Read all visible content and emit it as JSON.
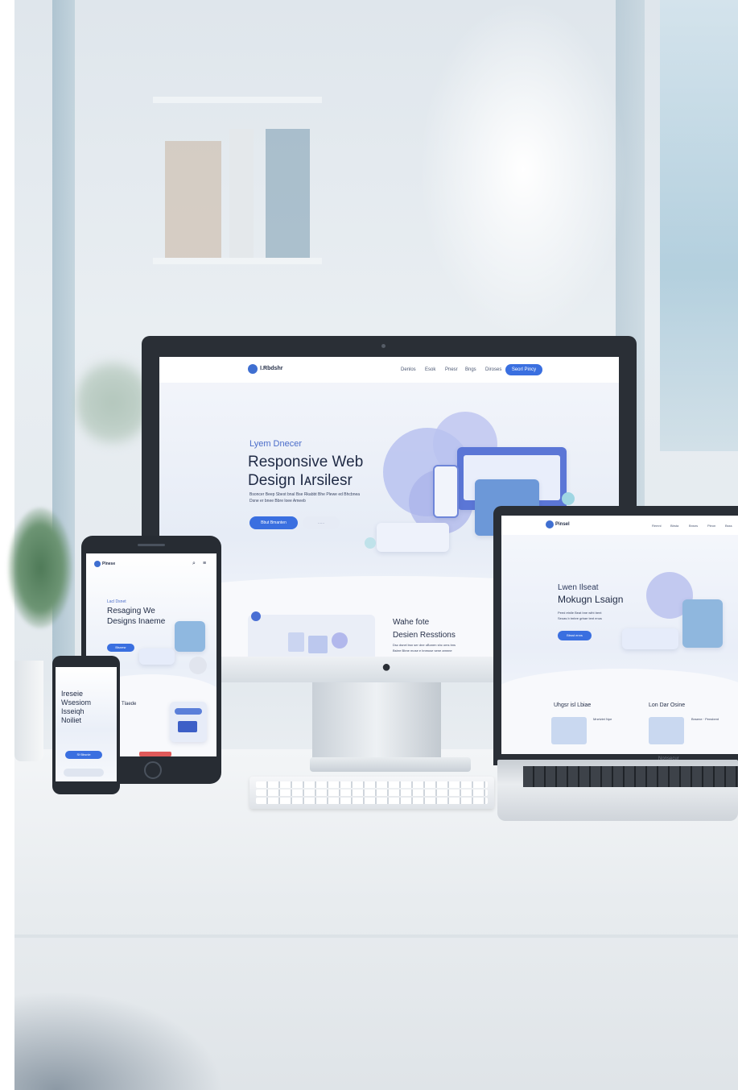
{
  "scene": {
    "colors": {
      "accent": "#3a6fe0",
      "bezel": "#2a2f36",
      "background": "#e3e9ee"
    }
  },
  "monitor": {
    "logo_text": "Ⅰ.Rbdshr",
    "logo_sub": "......",
    "nav_links": [
      "Denlos",
      "Esok",
      "Pnesr",
      "Bngs",
      "Diroses"
    ],
    "nav_cta": "Seorl Pincy",
    "kicker": "Lyem Dnecer",
    "headline_line1": "Responsive Web",
    "headline_line2": "Design Iᴀrsilesr",
    "body_line1": "Bsoncer Beep Sbest bnal Bse Rkabbt Bhe Plewe ed Bhcbnea",
    "body_line2": "Dsne er bnee Bbre loee Ameeb",
    "primary_button": "Bbut Bmanten",
    "secondary_button": "......",
    "section_title": "Wahe fote",
    "section_subtitle": "Desien Resstions",
    "section_body1": "Dsc dsnel bsn ser dne oBonen shc oms bns",
    "section_body2": "Bsbre Bbne mose e bnmuse sene amnne"
  },
  "laptop": {
    "logo_text": "Pinsel",
    "nav_links": [
      "Remnl",
      "Bbsta",
      "Bnsns",
      "Pleon",
      "Bsss"
    ],
    "kicker": "Lwen Ilseat",
    "headline": "Mokugn Lsaign",
    "body_line1": "Peed etnlle Beat bne wtht bent",
    "body_line2": "Seoas b tmbre grbae tent enus",
    "button": "Bbsst enns",
    "col1_title": "Uhgsr isl Lbiae",
    "col2_title": "Lon Dar Osine",
    "col1_text": "Mnelvlet Npe",
    "col2_text": "Bnsene · Pensbent",
    "brand": "Nonsecur"
  },
  "tablet": {
    "logo_text": "Plnese",
    "kicker": "Lacl Dsnet",
    "headline_line1": "Resaging We",
    "headline_line2": "Designs Inaeme",
    "button": "Blsnesr",
    "section_title": "Tlaede"
  },
  "phone": {
    "headline_line1": "Ireseie",
    "headline_line2": "Wsesiom",
    "headline_line3": "Isseiqh",
    "headline_line4": "Noiliet",
    "button": "Sl·Bbsnle"
  }
}
